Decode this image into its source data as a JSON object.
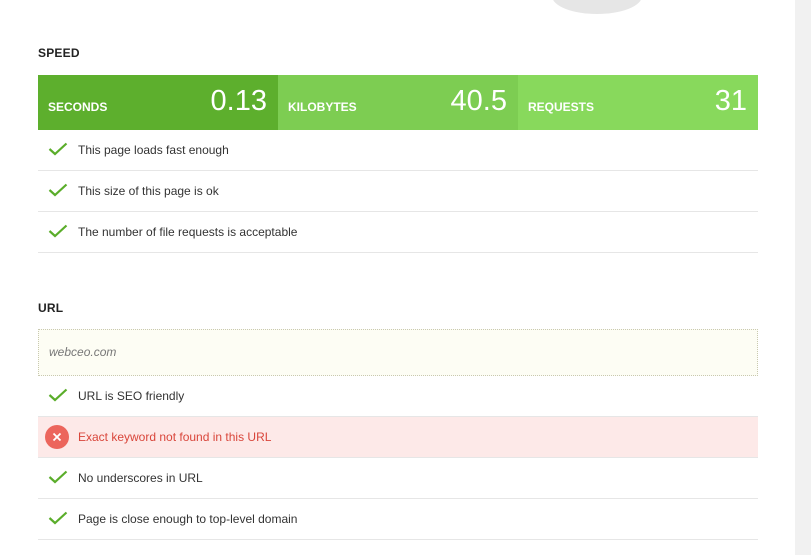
{
  "speed": {
    "title": "SPEED",
    "metrics": [
      {
        "label": "SECONDS",
        "value": "0.13",
        "color": "#5daf2d"
      },
      {
        "label": "KILOBYTES",
        "value": "40.5",
        "color": "#7dcd52"
      },
      {
        "label": "REQUESTS",
        "value": "31",
        "color": "#88d95c"
      }
    ],
    "checks": [
      {
        "text": "This page loads fast enough",
        "status": "pass"
      },
      {
        "text": "This size of this page is ok",
        "status": "pass"
      },
      {
        "text": "The number of file requests is acceptable",
        "status": "pass"
      }
    ]
  },
  "url": {
    "title": "URL",
    "value": "webceo.com",
    "checks": [
      {
        "text": "URL is SEO friendly",
        "status": "pass"
      },
      {
        "text": "Exact keyword not found in this URL",
        "status": "fail"
      },
      {
        "text": "No underscores in URL",
        "status": "pass"
      },
      {
        "text": "Page is close enough to top-level domain",
        "status": "pass"
      }
    ]
  },
  "colors": {
    "pass_check": "#5aad2a",
    "fail_bg": "#fde9e8",
    "fail_icon": "#ec655c",
    "fail_text": "#d9463b"
  }
}
